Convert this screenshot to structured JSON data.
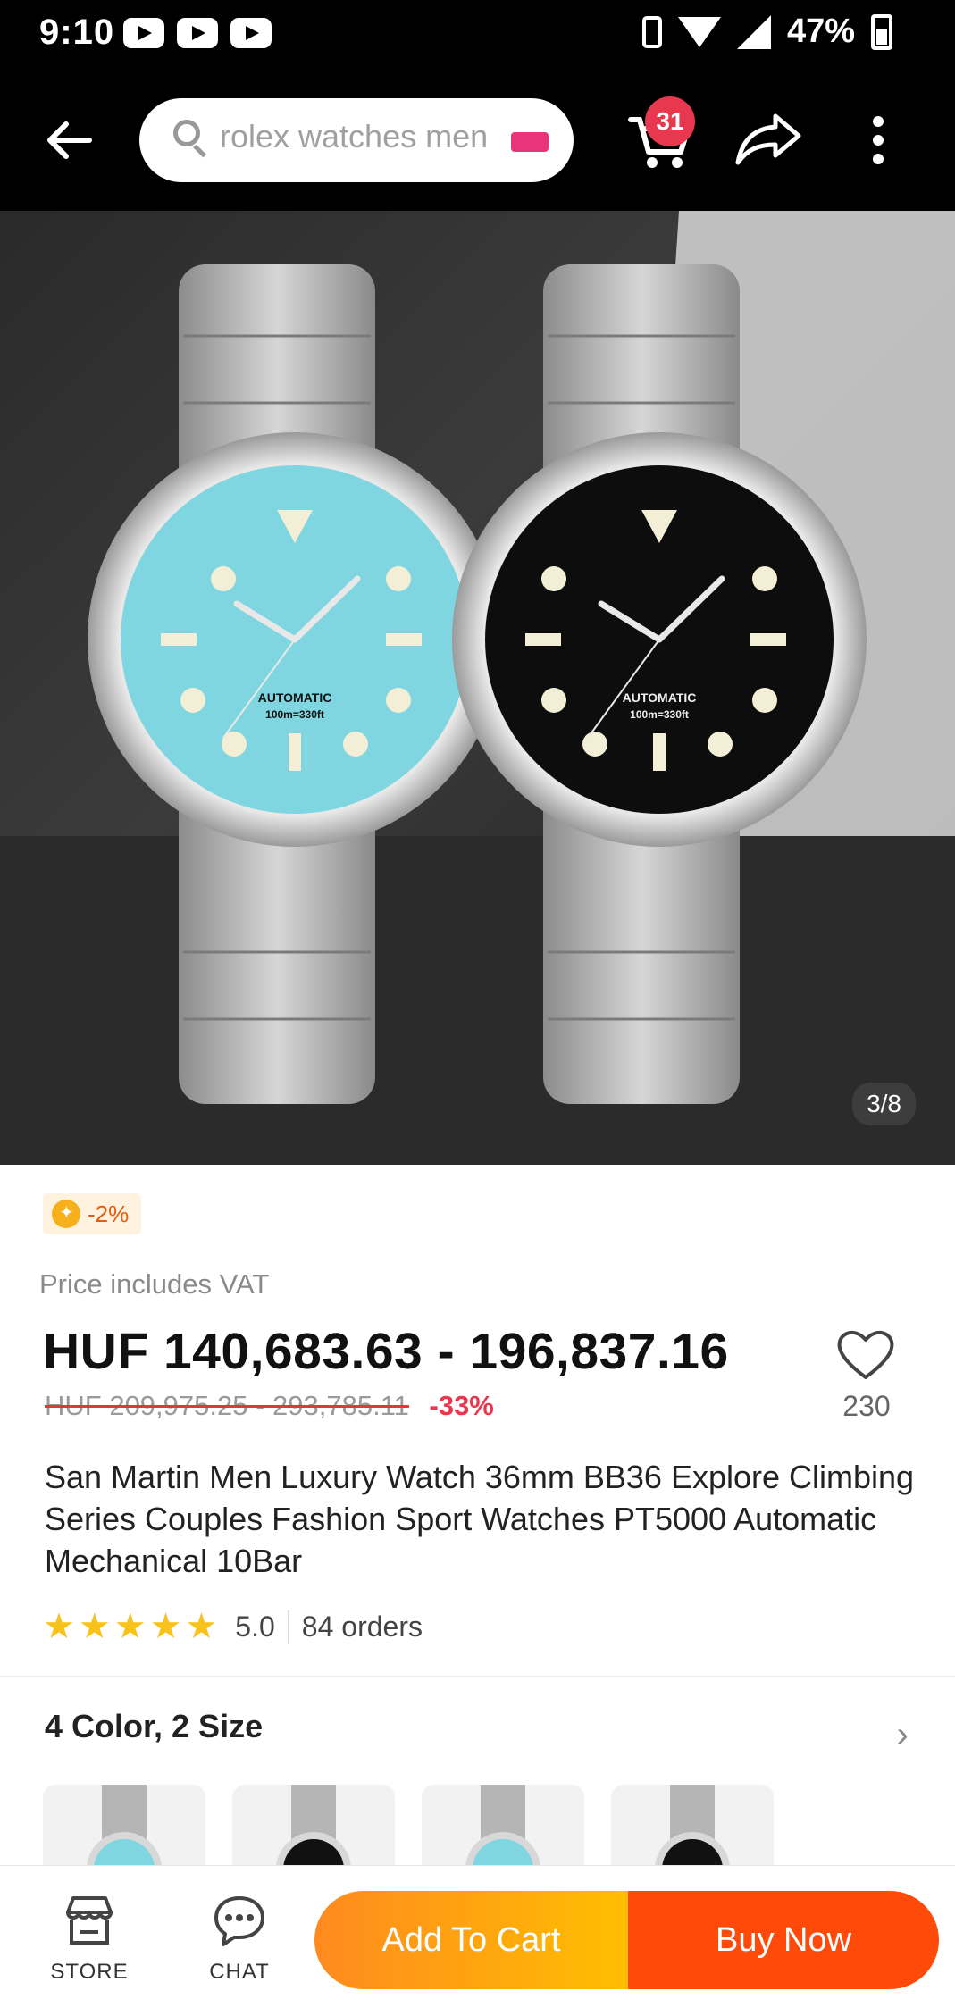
{
  "status_bar": {
    "time": "9:10",
    "battery": "47%"
  },
  "search": {
    "query": "rolex watches men"
  },
  "cart": {
    "badge": "31"
  },
  "image": {
    "counter": "3/8",
    "dial_label": "AUTOMATIC",
    "depth_label": "100m=330ft"
  },
  "product": {
    "coin_discount": "-2%",
    "vat_note": "Price includes VAT",
    "price_range": "HUF 140,683.63 - 196,837.16",
    "original_price": "HUF 209,975.25 - 293,785.11",
    "discount_percent": "-33%",
    "wishlist_count": "230",
    "title": "San Martin Men Luxury Watch 36mm BB36 Explore Climbing Series Couples Fashion Sport Watches PT5000 Automatic Mechanical 10Bar",
    "rating": "5.0",
    "orders": "84 orders",
    "variants": "4 Color, 2 Size"
  },
  "bottom_bar": {
    "store_label": "STORE",
    "chat_label": "CHAT",
    "add_to_cart_label": "Add To Cart",
    "buy_now_label": "Buy Now"
  },
  "colors": {
    "accent_orange": "#ff8a1f",
    "buy_red": "#ff4a0a",
    "badge_red": "#e8384f",
    "star_yellow": "#f8c21d"
  }
}
